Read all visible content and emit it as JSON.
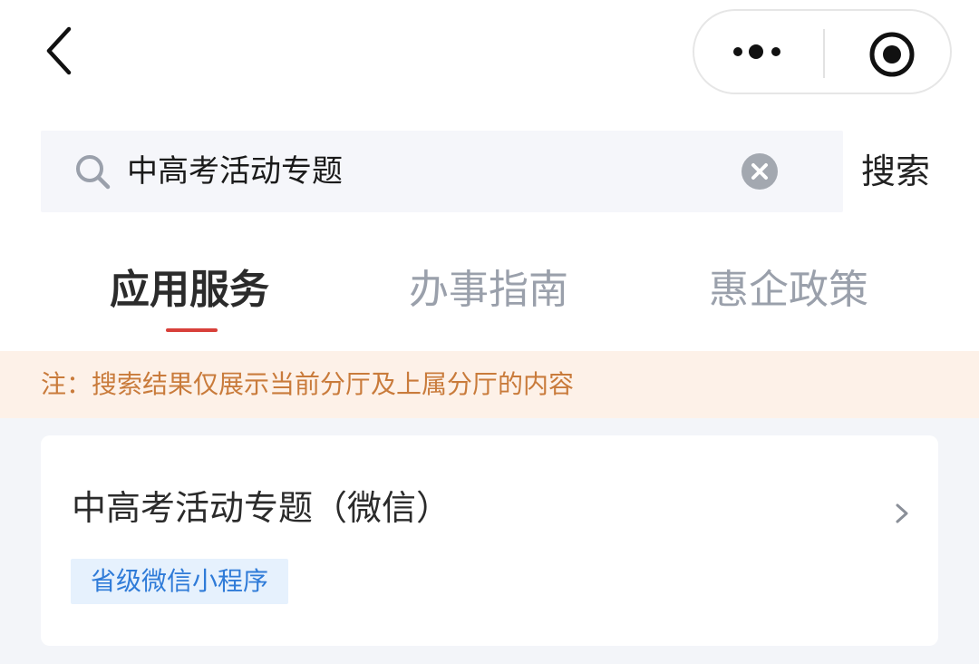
{
  "nav": {
    "back_icon": "chevron-left-icon",
    "more_icon": "more-dots-icon",
    "close_icon": "target-circle-icon"
  },
  "search": {
    "query": "中高考活动专题",
    "placeholder": "",
    "submit_label": "搜索"
  },
  "tabs": [
    {
      "label": "应用服务",
      "active": true
    },
    {
      "label": "办事指南",
      "active": false
    },
    {
      "label": "惠企政策",
      "active": false
    }
  ],
  "notice": {
    "text": "注：搜索结果仅展示当前分厅及上属分厅的内容"
  },
  "results": [
    {
      "title": "中高考活动专题（微信）",
      "tag": "省级微信小程序"
    }
  ],
  "colors": {
    "accent": "#d8403a",
    "tag_text": "#2f7bd8",
    "tag_bg": "#e6f1fd",
    "notice_text": "#c97b3b",
    "notice_bg": "#fdf1e8"
  }
}
